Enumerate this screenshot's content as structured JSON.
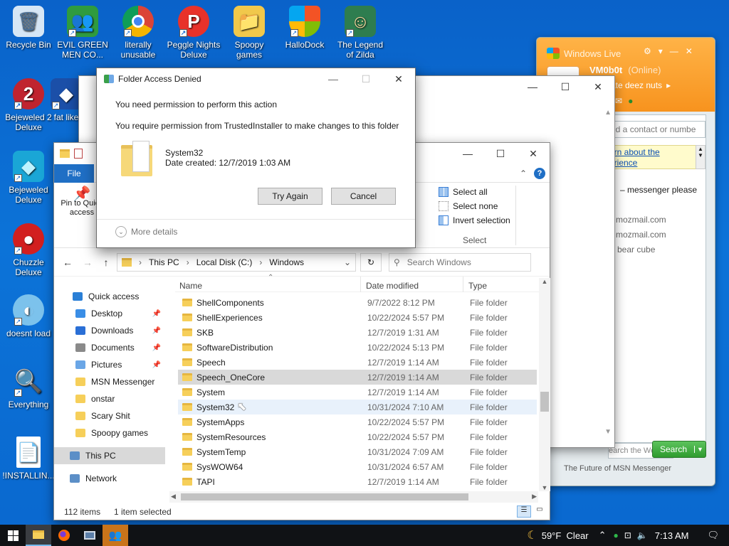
{
  "desktop": {
    "icons": [
      {
        "label": "Recycle Bin",
        "glyph": "🗑"
      },
      {
        "label": "EVIL GREEN MEN CO...",
        "glyph": "👥"
      },
      {
        "label": "literally unusable",
        "glyph": "◉"
      },
      {
        "label": "Peggle Nights Deluxe",
        "glyph": "P"
      },
      {
        "label": "Spoopy games",
        "glyph": "📁"
      },
      {
        "label": "HalloDock",
        "glyph": "⊞"
      },
      {
        "label": "The Legend of Zilda",
        "glyph": "☺"
      },
      {
        "label": "Bejeweled 2 Deluxe",
        "glyph": "2"
      },
      {
        "label": "fat like",
        "glyph": "◆"
      },
      {
        "label": "Bejeweled Deluxe",
        "glyph": "◆"
      },
      {
        "label": "Chuzzle Deluxe",
        "glyph": "●"
      },
      {
        "label": "doesnt load",
        "glyph": "◐"
      },
      {
        "label": "Everything",
        "glyph": "🔍"
      },
      {
        "label": "!INSTALLIN...",
        "glyph": "📄"
      }
    ]
  },
  "msn": {
    "title": "Windows Live",
    "username": "VM0b0t",
    "status": "(Online)",
    "personal_message": "rate deez nuts",
    "search_contacts_placeholder": "nd a contact or numbe",
    "learn_link_line1": "arn about the",
    "learn_link_line2": "erience",
    "contacts": [
      "messenger please",
      "mozmail.com",
      "mozmail.com",
      "bear cube"
    ],
    "search_web_placeholder": "earch the Web...",
    "search_button": "Search",
    "footer": "The Future of MSN Messenger"
  },
  "explorer": {
    "ribbon_tab_file": "File",
    "pin_label": "Pin to Quick access",
    "select_all": "Select all",
    "select_none": "Select none",
    "invert_selection": "Invert selection",
    "select_group": "Select",
    "breadcrumb": [
      "This PC",
      "Local Disk (C:)",
      "Windows"
    ],
    "search_placeholder": "Search Windows",
    "columns": {
      "name": "Name",
      "date": "Date modified",
      "type": "Type"
    },
    "nav": [
      {
        "label": "Quick access",
        "color": "#2a7fd6",
        "pinned": false
      },
      {
        "label": "Desktop",
        "color": "#3a8ee6",
        "pinned": true
      },
      {
        "label": "Downloads",
        "color": "#2a6fd6",
        "pinned": true
      },
      {
        "label": "Documents",
        "color": "#8a8a8a",
        "pinned": true
      },
      {
        "label": "Pictures",
        "color": "#6aa6e6",
        "pinned": true
      },
      {
        "label": "MSN Messenger",
        "color": "#f6cf5a",
        "pinned": false
      },
      {
        "label": "onstar",
        "color": "#f6cf5a",
        "pinned": false
      },
      {
        "label": "Scary Shit",
        "color": "#f6cf5a",
        "pinned": false
      },
      {
        "label": "Spoopy games",
        "color": "#f6cf5a",
        "pinned": false
      },
      {
        "label": "This PC",
        "color": "#5c8fc7",
        "pinned": false
      },
      {
        "label": "Network",
        "color": "#5c8fc7",
        "pinned": false
      }
    ],
    "files": [
      {
        "name": "ShellComponents",
        "date": "9/7/2022 8:12 PM",
        "type": "File folder"
      },
      {
        "name": "ShellExperiences",
        "date": "10/22/2024 5:57 PM",
        "type": "File folder"
      },
      {
        "name": "SKB",
        "date": "12/7/2019 1:31 AM",
        "type": "File folder"
      },
      {
        "name": "SoftwareDistribution",
        "date": "10/22/2024 5:13 PM",
        "type": "File folder"
      },
      {
        "name": "Speech",
        "date": "12/7/2019 1:14 AM",
        "type": "File folder"
      },
      {
        "name": "Speech_OneCore",
        "date": "12/7/2019 1:14 AM",
        "type": "File folder"
      },
      {
        "name": "System",
        "date": "12/7/2019 1:14 AM",
        "type": "File folder"
      },
      {
        "name": "System32",
        "date": "10/31/2024 7:10 AM",
        "type": "File folder"
      },
      {
        "name": "SystemApps",
        "date": "10/22/2024 5:57 PM",
        "type": "File folder"
      },
      {
        "name": "SystemResources",
        "date": "10/22/2024 5:57 PM",
        "type": "File folder"
      },
      {
        "name": "SystemTemp",
        "date": "10/31/2024 7:09 AM",
        "type": "File folder"
      },
      {
        "name": "SysWOW64",
        "date": "10/31/2024 6:57 AM",
        "type": "File folder"
      },
      {
        "name": "TAPI",
        "date": "12/7/2019 1:14 AM",
        "type": "File folder"
      }
    ],
    "status_items": "112 items",
    "status_selected": "1 item selected"
  },
  "dialog": {
    "title": "Folder Access Denied",
    "heading": "You need permission to perform this action",
    "message": "You require permission from TrustedInstaller to make changes to this folder",
    "folder_name": "System32",
    "date_created": "Date created: 12/7/2019 1:03 AM",
    "try_again": "Try Again",
    "cancel": "Cancel",
    "more_details": "More details"
  },
  "taskbar": {
    "weather": "59°F  Clear",
    "time": "7:13 AM"
  }
}
